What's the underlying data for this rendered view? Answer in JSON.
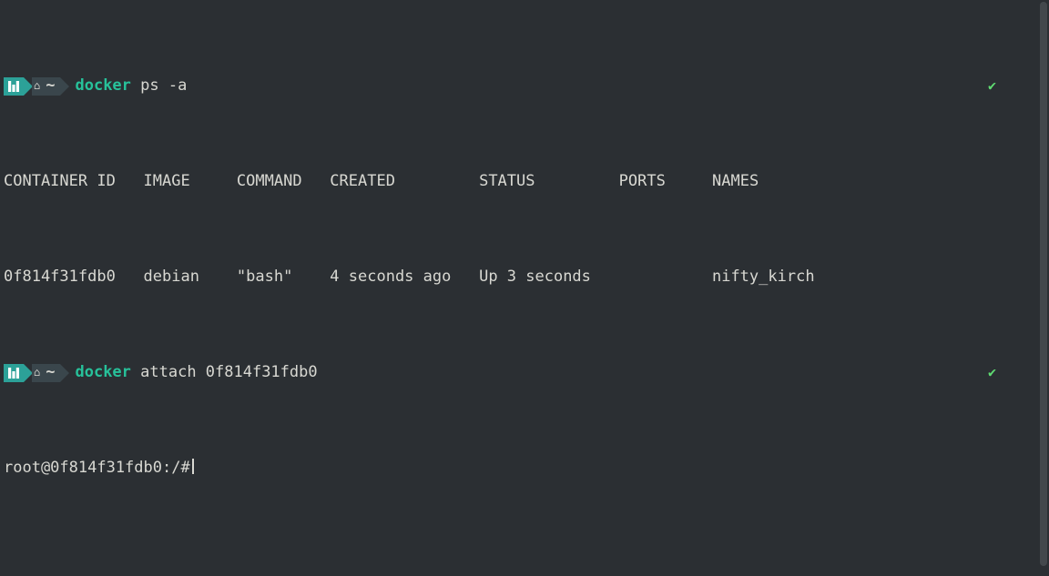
{
  "prompt1": {
    "keyword": "docker",
    "rest": " ps -a",
    "check": "✔"
  },
  "table": {
    "headers": {
      "container_id": "CONTAINER ID",
      "image": "IMAGE",
      "command": "COMMAND",
      "created": "CREATED",
      "status": "STATUS",
      "ports": "PORTS",
      "names": "NAMES"
    },
    "row": {
      "container_id": "0f814f31fdb0",
      "image": "debian",
      "command": "\"bash\"",
      "created": "4 seconds ago",
      "status": "Up 3 seconds",
      "ports": "",
      "names": "nifty_kirch"
    }
  },
  "prompt2": {
    "keyword": "docker",
    "rest": " attach 0f814f31fdb0",
    "check": "✔"
  },
  "shell": {
    "prompt": "root@0f814f31fdb0:/#"
  },
  "tilde": "~"
}
